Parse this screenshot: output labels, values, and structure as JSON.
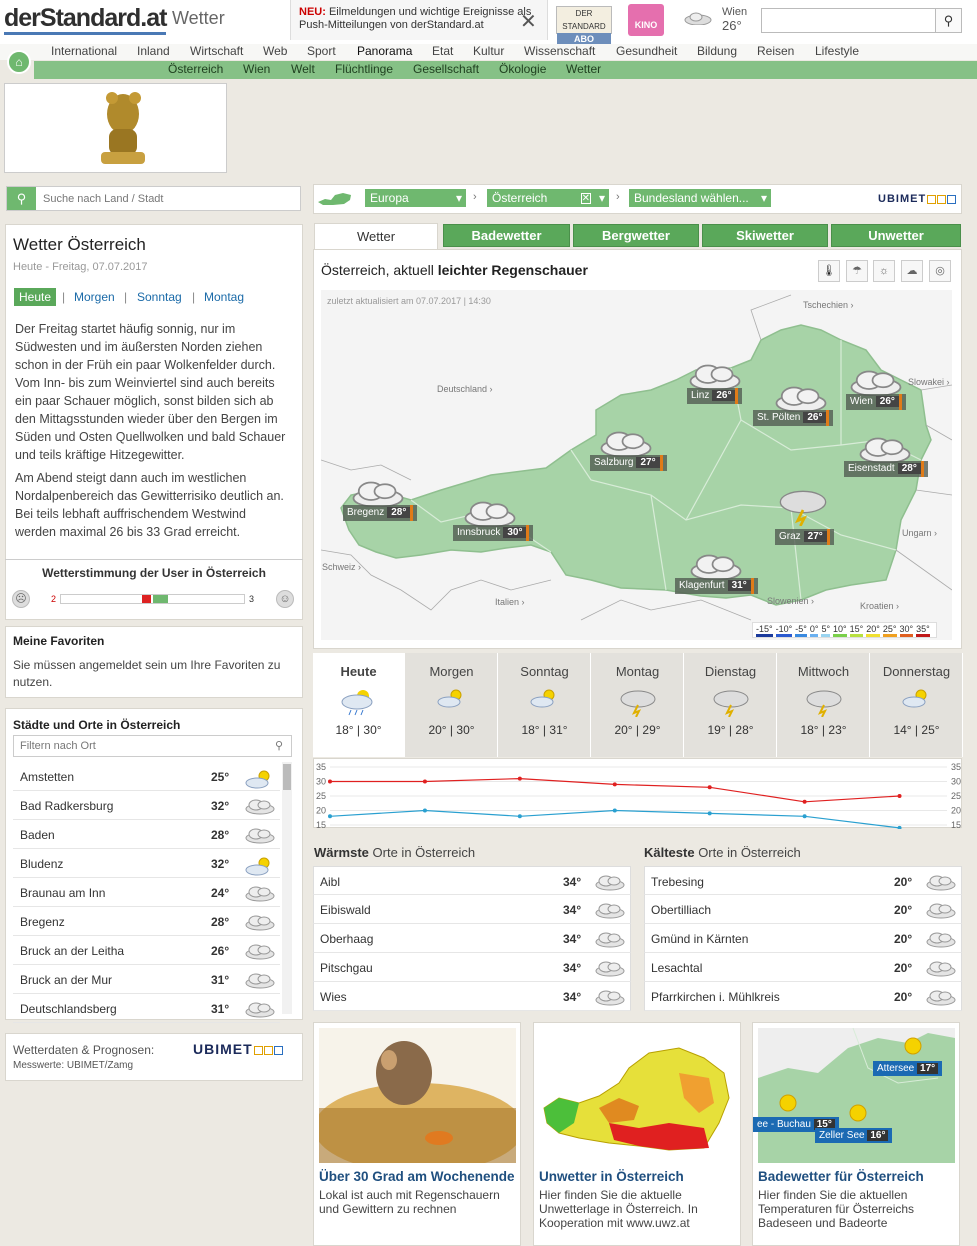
{
  "header": {
    "logo": "derStandard.at",
    "section": "Wetter",
    "push_new": "NEU:",
    "push_text": "Eilmeldungen und wichtige Ereignisse als Push-Mitteilungen von derStandard.at",
    "abo_top": "DER STANDARD",
    "abo_label": "ABO",
    "kino_label": "KINO",
    "weather_city": "Wien",
    "weather_temp": "26°",
    "search_placeholder": ""
  },
  "nav_primary": [
    "International",
    "Inland",
    "Wirtschaft",
    "Web",
    "Sport",
    "Panorama",
    "Etat",
    "Kultur",
    "Wissenschaft",
    "Gesundheit",
    "Bildung",
    "Reisen",
    "Lifestyle"
  ],
  "nav_secondary": [
    "Österreich",
    "Wien",
    "Welt",
    "Flüchtlinge",
    "Gesellschaft",
    "Ökologie",
    "Wetter"
  ],
  "left": {
    "search_placeholder": "Suche nach Land / Stadt",
    "title": "Wetter Österreich",
    "date": "Heute - Freitag, 07.07.2017",
    "day_tabs": [
      "Heute",
      "Morgen",
      "Sonntag",
      "Montag"
    ],
    "paragraph1": "Der Freitag startet häufig sonnig, nur im Südwesten und im äußersten Norden ziehen schon in der Früh ein paar Wolkenfelder durch. Vom Inn- bis zum Weinviertel sind auch bereits ein paar Schauer möglich, sonst bilden sich ab den Mittagsstunden wieder über den Bergen im Süden und Osten Quellwolken und bald Schauer und teils kräftige Hitzegewitter.",
    "paragraph2": "Am Abend steigt dann auch im westlichen Nordalpenbereich das Gewitterrisiko deutlich an. Bei teils lebhaft auffrischendem Westwind werden maximal 26 bis 33 Grad erreicht.",
    "mood_title": "Wetterstimmung der User in Österreich",
    "mood_neg": "2",
    "mood_pos": "3",
    "fav_title": "Meine Favoriten",
    "fav_text": "Sie müssen angemeldet sein um Ihre Favoriten zu nutzen.",
    "cities_title": "Städte und Orte in Österreich",
    "filter_placeholder": "Filtern nach Ort",
    "cities": [
      {
        "name": "Amstetten",
        "temp": "25°",
        "icon": "sun-cloud"
      },
      {
        "name": "Bad Radkersburg",
        "temp": "32°",
        "icon": "cloud"
      },
      {
        "name": "Baden",
        "temp": "28°",
        "icon": "cloud"
      },
      {
        "name": "Bludenz",
        "temp": "32°",
        "icon": "sun-cloud"
      },
      {
        "name": "Braunau am Inn",
        "temp": "24°",
        "icon": "cloud"
      },
      {
        "name": "Bregenz",
        "temp": "28°",
        "icon": "cloud"
      },
      {
        "name": "Bruck an der Leitha",
        "temp": "26°",
        "icon": "cloud"
      },
      {
        "name": "Bruck an der Mur",
        "temp": "31°",
        "icon": "cloud"
      },
      {
        "name": "Deutschlandsberg",
        "temp": "31°",
        "icon": "cloud"
      }
    ],
    "data_label": "Wetterdaten & Prognosen:",
    "data_sub": "Messwerte: UBIMET/Zamg",
    "ubimet": "UBIMET"
  },
  "breadcrumb": {
    "europa": "Europa",
    "austria": "Österreich",
    "state": "Bundesland wählen...",
    "provider": "UBIMET"
  },
  "tabs": {
    "active": "Wetter",
    "items": [
      "Badewetter",
      "Bergwetter",
      "Skiwetter",
      "Unwetter"
    ]
  },
  "map": {
    "title_prefix": "Österreich, aktuell ",
    "title_bold": "leichter Regenschauer",
    "updated": "zuletzt aktualisiert am 07.07.2017 | 14:30",
    "neighbors": [
      "Tschechien ›",
      "Deutschland ›",
      "Slowakei ›",
      "Ungarn ›",
      "Schweiz ›",
      "Italien ›",
      "Slowenien ›",
      "Kroatien ›"
    ],
    "cities": [
      {
        "name": "Linz",
        "temp": "26°"
      },
      {
        "name": "St. Pölten",
        "temp": "26°"
      },
      {
        "name": "Wien",
        "temp": "26°"
      },
      {
        "name": "Salzburg",
        "temp": "27°"
      },
      {
        "name": "Eisenstadt",
        "temp": "28°"
      },
      {
        "name": "Bregenz",
        "temp": "28°"
      },
      {
        "name": "Innsbruck",
        "temp": "30°"
      },
      {
        "name": "Graz",
        "temp": "27°"
      },
      {
        "name": "Klagenfurt",
        "temp": "31°"
      }
    ],
    "legend": [
      "-15°",
      "-10°",
      "-5°",
      "0°",
      "5°",
      "10°",
      "15°",
      "20°",
      "25°",
      "30°",
      "35°"
    ]
  },
  "forecast": [
    {
      "day": "Heute",
      "min": "18°",
      "max": "30°",
      "icon": "shower"
    },
    {
      "day": "Morgen",
      "min": "20°",
      "max": "30°",
      "icon": "sun-cloud"
    },
    {
      "day": "Sonntag",
      "min": "18°",
      "max": "31°",
      "icon": "sun-cloud"
    },
    {
      "day": "Montag",
      "min": "20°",
      "max": "29°",
      "icon": "storm"
    },
    {
      "day": "Dienstag",
      "min": "19°",
      "max": "28°",
      "icon": "storm"
    },
    {
      "day": "Mittwoch",
      "min": "18°",
      "max": "23°",
      "icon": "storm"
    },
    {
      "day": "Donnerstag",
      "min": "14°",
      "max": "25°",
      "icon": "sun-cloud"
    }
  ],
  "chart_data": {
    "type": "line",
    "categories": [
      "Heute",
      "Morgen",
      "Sonntag",
      "Montag",
      "Dienstag",
      "Mittwoch",
      "Donnerstag"
    ],
    "series": [
      {
        "values": [
          30,
          30,
          31,
          29,
          28,
          23,
          25
        ],
        "color": "#e02020"
      },
      {
        "values": [
          18,
          20,
          18,
          20,
          19,
          18,
          14
        ],
        "color": "#2aa0d0"
      }
    ],
    "yticks": [
      "35",
      "30",
      "25",
      "20",
      "15"
    ],
    "ylim": [
      15,
      35
    ]
  },
  "warmest": {
    "title_bold": "Wärmste",
    "title_rest": " Orte in Österreich",
    "rows": [
      {
        "name": "Aibl",
        "temp": "34°"
      },
      {
        "name": "Eibiswald",
        "temp": "34°"
      },
      {
        "name": "Oberhaag",
        "temp": "34°"
      },
      {
        "name": "Pitschgau",
        "temp": "34°"
      },
      {
        "name": "Wies",
        "temp": "34°"
      }
    ]
  },
  "coldest": {
    "title_bold": "Kälteste",
    "title_rest": " Orte in Österreich",
    "rows": [
      {
        "name": "Trebesing",
        "temp": "20°"
      },
      {
        "name": "Obertilliach",
        "temp": "20°"
      },
      {
        "name": "Gmünd in Kärnten",
        "temp": "20°"
      },
      {
        "name": "Lesachtal",
        "temp": "20°"
      },
      {
        "name": "Pfarrkirchen i. Mühlkreis",
        "temp": "20°"
      }
    ]
  },
  "teasers": [
    {
      "title": "Über 30 Grad am Wochenende",
      "text": "Lokal ist auch mit Regenschauern und Gewittern zu rechnen"
    },
    {
      "title": "Unwetter in Österreich",
      "text": "Hier finden Sie die aktuelle Unwetterlage in Österreich. In Kooperation mit www.uwz.at"
    },
    {
      "title": "Badewetter für Österreich",
      "text": "Hier finden Sie die aktuellen Temperaturen für Österreichs Badeseen und Badeorte",
      "labels": [
        {
          "name": "Attersee",
          "temp": "17°"
        },
        {
          "name": "ee - Buchau",
          "temp": "15°"
        },
        {
          "name": "Zeller See",
          "temp": "16°"
        }
      ]
    }
  ]
}
